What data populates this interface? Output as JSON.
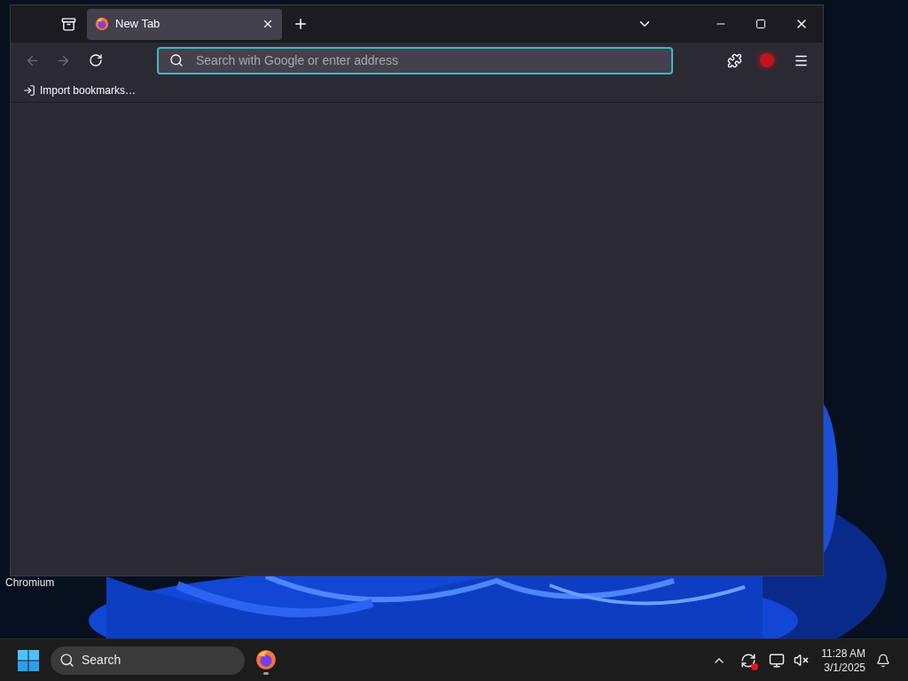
{
  "desktop": {
    "icons": [
      {
        "label": "Chromium"
      }
    ]
  },
  "browser": {
    "tabs": [
      {
        "title": "New Tab",
        "selected": true
      }
    ],
    "toolbar": {
      "back": {
        "disabled": true
      },
      "forward": {
        "disabled": true
      },
      "reload": {
        "disabled": false
      }
    },
    "address": {
      "placeholder": "Search with Google or enter address"
    },
    "bookmarks": [
      {
        "label": "Import bookmarks…"
      }
    ]
  },
  "taskbar": {
    "search": {
      "placeholder": "Search"
    },
    "apps": [
      {
        "running": true
      }
    ],
    "clock": {
      "time": "11:28 AM",
      "date": "3/1/2025"
    }
  }
}
